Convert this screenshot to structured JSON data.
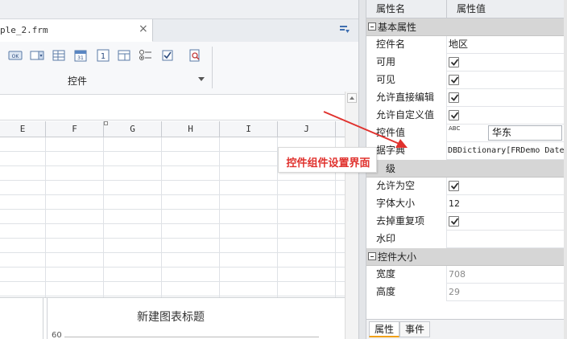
{
  "editor": {
    "file_tab": "ple_2.frm",
    "close_glyph": "×",
    "toolbar_group_label": "控件",
    "column_headers": [
      "E",
      "F",
      "G",
      "H",
      "I",
      "J"
    ]
  },
  "chart": {
    "title": "新建图表标题",
    "axis_tick": "60"
  },
  "annotation": {
    "callout_text": "控件组件设置界面",
    "color": "#e0322e"
  },
  "property_panel": {
    "header_name": "属性名",
    "header_value": "属性值",
    "groups": {
      "basic": "基本属性",
      "advanced_partial": "级",
      "size": "控件大小"
    },
    "rows": {
      "widget_name": {
        "label": "控件名",
        "value": "地区"
      },
      "enabled": {
        "label": "可用",
        "checked": true
      },
      "visible": {
        "label": "可见",
        "checked": true
      },
      "allow_direct_edit": {
        "label": "允许直接编辑",
        "checked": true
      },
      "allow_custom_value": {
        "label": "允许自定义值",
        "checked": true
      },
      "widget_value": {
        "label": "控件值",
        "value": "华东",
        "icon": "ABC"
      },
      "data_dictionary": {
        "label": "数据字典",
        "label_visible": "据字典",
        "value": "DBDictionary[FRDemo Date"
      },
      "allow_empty": {
        "label": "允许为空",
        "checked": true
      },
      "font_size": {
        "label": "字体大小",
        "value": "12"
      },
      "remove_duplicates": {
        "label": "去掉重复项",
        "checked": true
      },
      "watermark": {
        "label": "水印",
        "value": ""
      },
      "width": {
        "label": "宽度",
        "value": "708"
      },
      "height": {
        "label": "高度",
        "value": "29"
      }
    },
    "tabs": {
      "properties": "属性",
      "events": "事件"
    }
  }
}
